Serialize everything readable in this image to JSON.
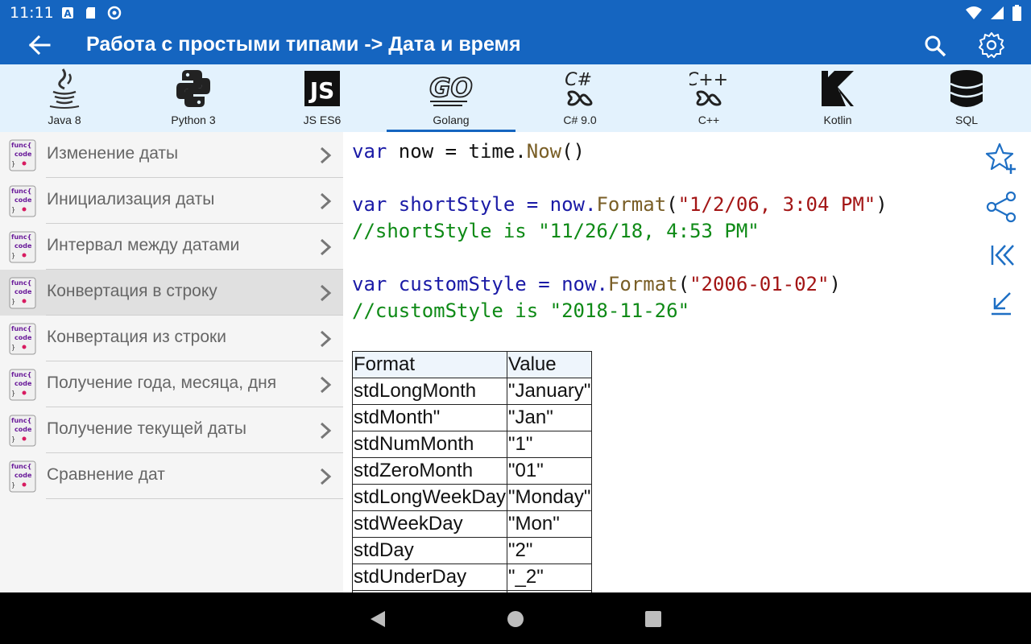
{
  "status": {
    "time": "11:11",
    "icons": [
      "keyboard-a-icon",
      "sd-card-icon",
      "sync-icon",
      "wifi-icon",
      "signal-icon",
      "battery-icon"
    ]
  },
  "toolbar": {
    "title": "Работа с простыми типами -> Дата и время",
    "back_icon": "arrow-back-icon",
    "search_icon": "search-icon",
    "settings_icon": "gear-icon"
  },
  "languages": [
    {
      "label": "Java 8",
      "icon": "java-icon"
    },
    {
      "label": "Python 3",
      "icon": "python-icon"
    },
    {
      "label": "JS ES6",
      "icon": "js-icon"
    },
    {
      "label": "Golang",
      "icon": "golang-icon",
      "active": true
    },
    {
      "label": "C# 9.0",
      "icon": "csharp-icon"
    },
    {
      "label": "C++",
      "icon": "cpp-icon"
    },
    {
      "label": "Kotlin",
      "icon": "kotlin-icon"
    },
    {
      "label": "SQL",
      "icon": "database-icon"
    }
  ],
  "topics": [
    {
      "label": "Изменение даты"
    },
    {
      "label": "Инициализация даты"
    },
    {
      "label": "Интервал между датами"
    },
    {
      "label": "Конвертация в строку",
      "selected": true
    },
    {
      "label": "Конвертация из строки"
    },
    {
      "label": "Получение года, месяца, дня"
    },
    {
      "label": "Получение текущей даты"
    },
    {
      "label": "Сравнение дат"
    }
  ],
  "code": {
    "l1_kw": "var",
    "l1_rest": " now = time.",
    "l1_fn": "Now",
    "l1_end": "()",
    "l2_kw": "var",
    "l2_rest": " shortStyle = now.",
    "l2_fn": "Format",
    "l2_open": "(",
    "l2_str": "\"1/2/06, 3:04 PM\"",
    "l2_close": ")",
    "l3_cm": "//shortStyle is \"11/26/18, 4:53 PM\"",
    "l4_kw": "var",
    "l4_rest": " customStyle = now.",
    "l4_fn": "Format",
    "l4_open": "(",
    "l4_str": "\"2006-01-02\"",
    "l4_close": ")",
    "l5_cm": "//customStyle is \"2018-11-26\""
  },
  "table": {
    "headers": [
      "Format",
      "Value"
    ],
    "rows": [
      [
        "stdLongMonth",
        "\"January\""
      ],
      [
        "stdMonth\"",
        "\"Jan\""
      ],
      [
        "stdNumMonth",
        "\"1\""
      ],
      [
        "stdZeroMonth",
        "\"01\""
      ],
      [
        "stdLongWeekDay",
        "\"Monday\""
      ],
      [
        "stdWeekDay",
        "\"Mon\""
      ],
      [
        "stdDay",
        "\"2\""
      ],
      [
        "stdUnderDay",
        "\"_2\""
      ]
    ]
  },
  "side_actions": [
    "star-add-icon",
    "share-icon",
    "skip-first-icon",
    "collapse-icon"
  ],
  "nav": [
    "back-triangle-icon",
    "home-circle-icon",
    "recents-square-icon"
  ],
  "colors": {
    "primary": "#1565c0",
    "tab_bg": "#e3f2fd",
    "keyword": "#1a1aa6",
    "string": "#a31515",
    "comment": "#0e8a16",
    "function": "#795e26"
  }
}
